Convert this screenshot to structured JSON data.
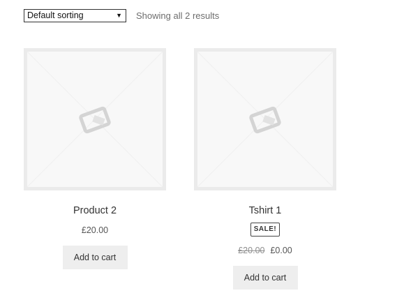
{
  "toolbar": {
    "sort_selected": "Default sorting",
    "result_count": "Showing all 2 results"
  },
  "products": [
    {
      "title": "Product 2",
      "price": "£20.00",
      "button_label": "Add to cart",
      "image_icon": "placeholder-image-icon"
    },
    {
      "title": "Tshirt 1",
      "sale_badge": "SALE!",
      "regular_price": "£20.00",
      "sale_price": "£0.00",
      "button_label": "Add to cart",
      "image_icon": "placeholder-image-icon"
    }
  ],
  "colors": {
    "button_bg": "#eeeeee",
    "thumb_border": "#ebebeb",
    "muted_text": "#6d6d6d"
  }
}
